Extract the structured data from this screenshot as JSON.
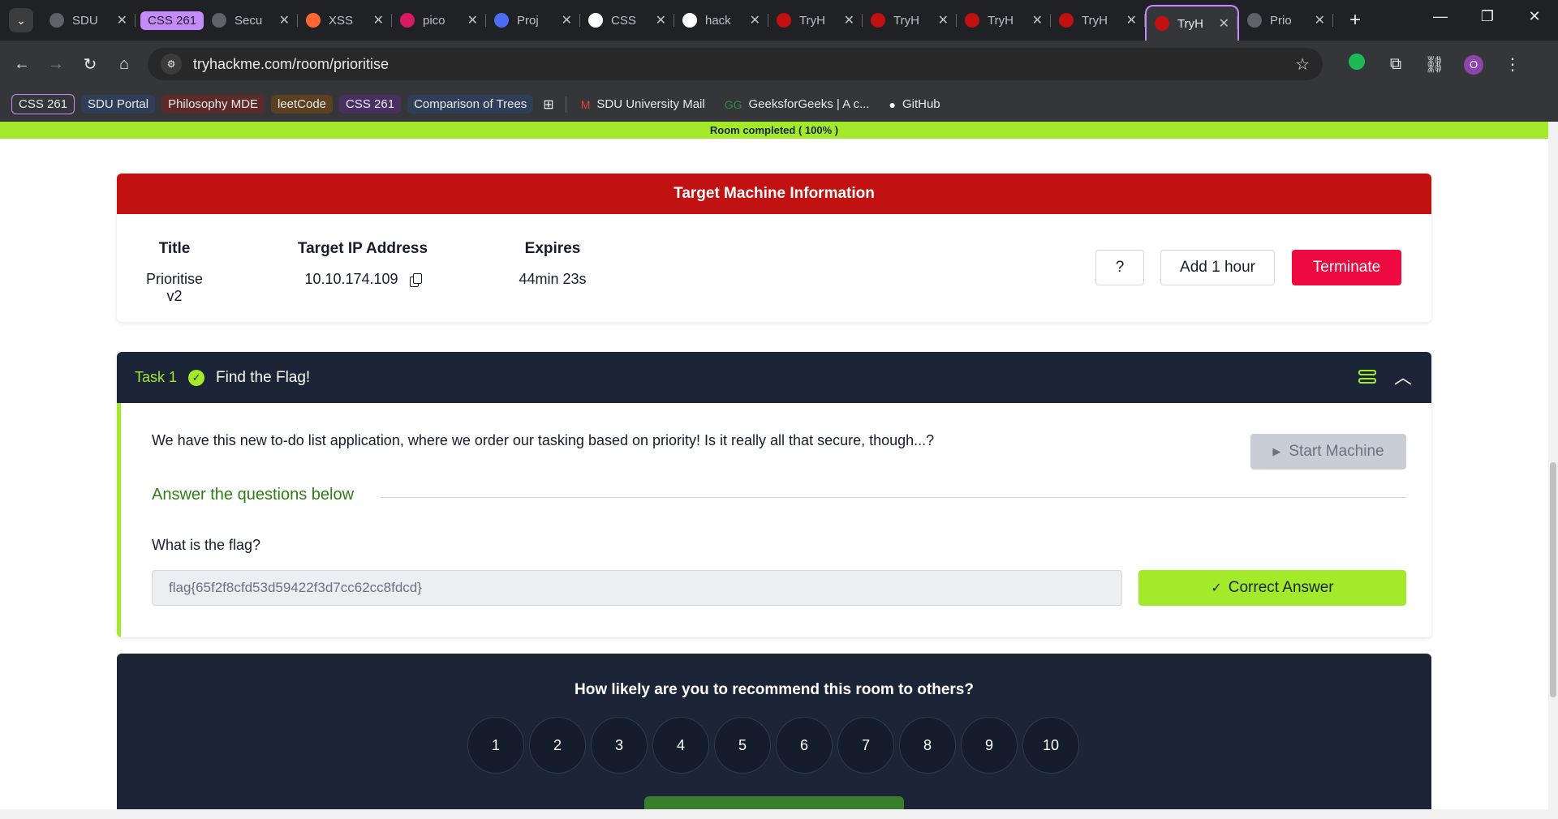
{
  "browser": {
    "tabs": [
      {
        "title": "SDU",
        "favicon": "globe-icon",
        "color": "#5f6368"
      },
      {
        "title": "Secu",
        "favicon": "globe-icon",
        "color": "#5f6368",
        "group": "CSS 261"
      },
      {
        "title": "XSS",
        "favicon": "portswigger-icon",
        "color": "#ff6633"
      },
      {
        "title": "pico",
        "favicon": "picoctf-icon",
        "color": "#d81b60"
      },
      {
        "title": "Proj",
        "favicon": "project-icon",
        "color": "#4a6cf7"
      },
      {
        "title": "CSS",
        "favicon": "github-icon",
        "color": "#ffffff"
      },
      {
        "title": "hack",
        "favicon": "github-icon",
        "color": "#ffffff"
      },
      {
        "title": "TryH",
        "favicon": "tryhackme-icon",
        "color": "#c11111"
      },
      {
        "title": "TryH",
        "favicon": "tryhackme-icon",
        "color": "#c11111"
      },
      {
        "title": "TryH",
        "favicon": "tryhackme-icon",
        "color": "#c11111"
      },
      {
        "title": "TryH",
        "favicon": "tryhackme-icon",
        "color": "#c11111"
      },
      {
        "title": "TryH",
        "favicon": "tryhackme-icon",
        "color": "#c11111",
        "active": true
      },
      {
        "title": "Prio",
        "favicon": "globe-icon",
        "color": "#5f6368"
      }
    ],
    "url": "tryhackme.com/room/prioritise",
    "profile_initial": "O",
    "bookmarks": [
      {
        "label": "CSS 261",
        "style": "g-purple"
      },
      {
        "label": "SDU Portal",
        "style": "g-blue"
      },
      {
        "label": "Philosophy MDE",
        "style": "g-red"
      },
      {
        "label": "leetCode",
        "style": "g-orange"
      },
      {
        "label": "CSS 261",
        "style": "g-purple2"
      },
      {
        "label": "Comparison of Trees",
        "style": "g-blue2"
      }
    ],
    "bookmarks_plain": [
      {
        "label": "SDU University Mail",
        "icon": "gmail-icon",
        "glyph": "M",
        "color": "#ea4335"
      },
      {
        "label": "GeeksforGeeks | A c...",
        "icon": "geeksforgeeks-icon",
        "glyph": "GG",
        "color": "#2f8d46"
      },
      {
        "label": "GitHub",
        "icon": "github-icon",
        "glyph": "●",
        "color": "#ffffff"
      }
    ]
  },
  "page": {
    "progress_text": "Room completed ( 100% )",
    "progress_value": 1.0,
    "colors": {
      "accent_green": "#a3ea2a",
      "header_red": "#c11111",
      "navy": "#1c2538",
      "terminate": "#ee0a40"
    },
    "machine": {
      "heading": "Target Machine Information",
      "title_label": "Title",
      "title_value": "Prioritise v2",
      "ip_label": "Target IP Address",
      "ip_value": "10.10.174.109",
      "expires_label": "Expires",
      "expires_value": "44min 23s",
      "help_label": "?",
      "add_hour_label": "Add 1 hour",
      "terminate_label": "Terminate"
    },
    "task": {
      "number": "Task 1",
      "title": "Find the Flag!",
      "description": "We have this new to-do list application, where we order our tasking based on priority! Is it really all that secure, though...?",
      "start_machine_label": "Start Machine",
      "answer_heading": "Answer the questions below",
      "question": "What is the flag?",
      "answer_value": "flag{65f2f8cfd53d59422f3d7cc62cc8fdcd}",
      "correct_label": "Correct Answer"
    },
    "rating": {
      "question": "How likely are you to recommend this room to others?",
      "options": [
        "1",
        "2",
        "3",
        "4",
        "5",
        "6",
        "7",
        "8",
        "9",
        "10"
      ]
    }
  }
}
